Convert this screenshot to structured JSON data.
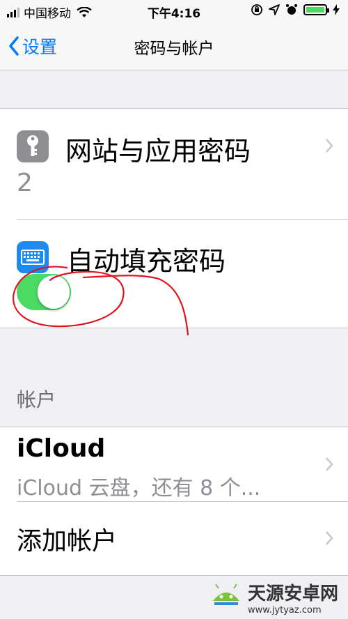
{
  "status_bar": {
    "carrier": "中国移动",
    "time": "下午4:16",
    "battery_color": "#4cd964"
  },
  "nav": {
    "back_label": "设置",
    "title": "密码与帐户"
  },
  "passwords_group": {
    "website_passwords": {
      "icon": "key-icon",
      "label": "网站与应用密码",
      "count": "2"
    },
    "autofill": {
      "icon": "keyboard-icon",
      "label": "自动填充密码",
      "enabled": true
    }
  },
  "accounts_section": {
    "header": "帐户",
    "items": [
      {
        "title": "iCloud",
        "subtitle": "iCloud 云盘，还有 8 个..."
      },
      {
        "title": "添加帐户"
      }
    ]
  },
  "watermark": {
    "name": "天源安卓网",
    "url": "www.jytyaz.com"
  },
  "colors": {
    "accent": "#007aff",
    "toggle_on": "#4cd964",
    "annotation": "#e0141e"
  }
}
